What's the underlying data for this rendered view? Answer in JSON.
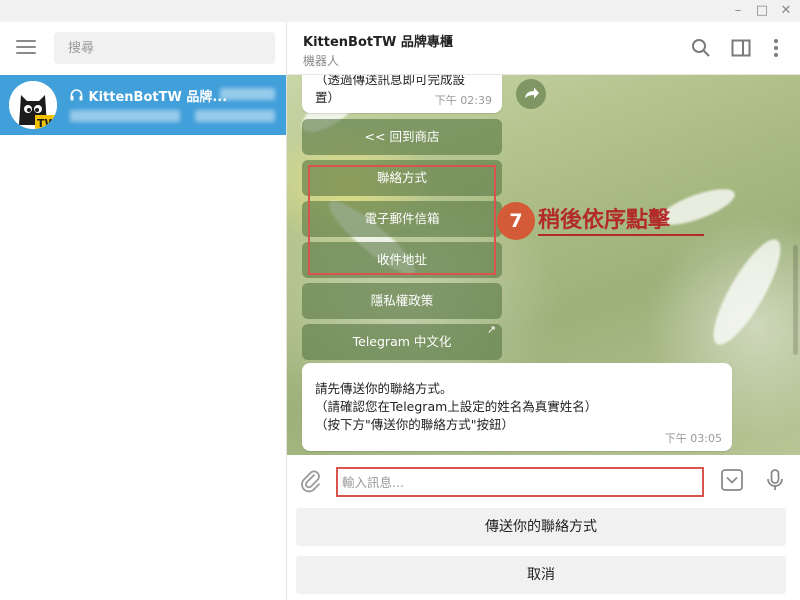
{
  "window": {
    "minimize": "–",
    "maximize": "□",
    "close": "✕"
  },
  "sidebar": {
    "search_placeholder": "搜尋",
    "chat": {
      "name": "KittenBotTW 品牌..."
    }
  },
  "header": {
    "title": "KittenBotTW 品牌專櫃",
    "subtitle": "機器人"
  },
  "messages": [
    {
      "text_lines": [
        "（透過傳送訊息即可完成設",
        "置）"
      ],
      "time": "下午 02:39"
    },
    {
      "text_lines": [
        "請先傳送你的聯絡方式。",
        "（請確認您在Telegram上設定的姓名為真實姓名）",
        "（按下方\"傳送你的聯絡方式\"按鈕）"
      ],
      "time": "下午 03:05"
    }
  ],
  "inline_keyboard": [
    {
      "label": "<< 回到商店"
    },
    {
      "label": "聯絡方式"
    },
    {
      "label": "電子郵件信箱"
    },
    {
      "label": "收件地址"
    },
    {
      "label": "隱私權政策"
    },
    {
      "label": "Telegram 中文化",
      "external": true
    }
  ],
  "annotation": {
    "step": "7",
    "text": "稍後依序點擊"
  },
  "composer": {
    "placeholder": "輸入訊息..."
  },
  "reply_keyboard": [
    {
      "label": "傳送你的聯絡方式"
    },
    {
      "label": "取消"
    }
  ],
  "colors": {
    "accent": "#419fd9",
    "highlight": "#d9534f",
    "badge": "#d35b38"
  }
}
